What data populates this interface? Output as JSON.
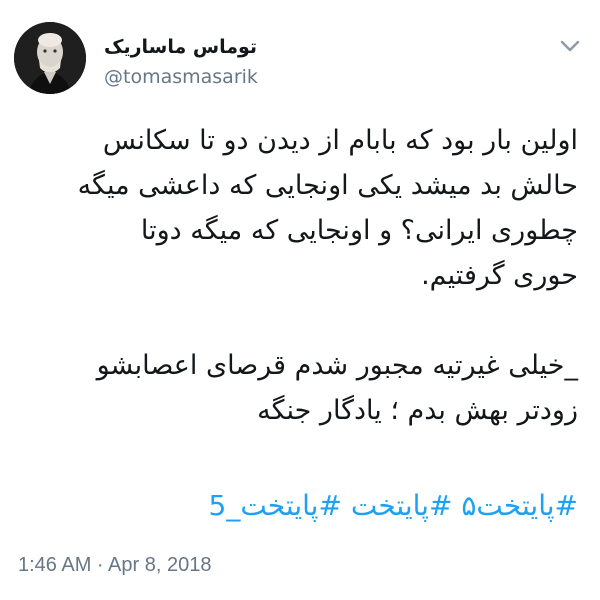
{
  "user": {
    "display_name": "توماس ماساریک",
    "handle": "@tomasmasarik"
  },
  "tweet": {
    "paragraph1": [
      "اولین بار بود که بابام از دیدن دو تا سکانس",
      "حالش بد میشد یکی اونجایی که داعشی میگه",
      "چطوری ایرانی؟ و اونجایی که میگه دوتا",
      "حوری گرفتیم."
    ],
    "paragraph2": [
      "_خیلی غیرتیه مجبور شدم قرصای اعصابشو",
      "زودتر بهش بدم ؛ یادگار جنگه"
    ],
    "hashtags": [
      "#پایتخت۵",
      "#پایتخت",
      "#پایتخت_5"
    ]
  },
  "timestamp": "1:46 AM · Apr 8, 2018",
  "colors": {
    "link": "#1da1f2",
    "secondary_text": "#657786",
    "primary_text": "#14171a"
  },
  "icons": [
    "avatar-portrait",
    "chevron-down-icon"
  ]
}
